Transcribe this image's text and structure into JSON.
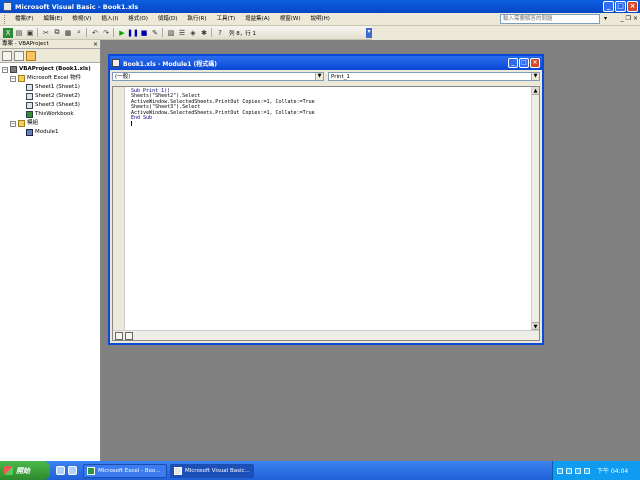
{
  "window": {
    "title": "Microsoft Visual Basic - Book1.xls"
  },
  "menu": {
    "items": [
      "檔案(F)",
      "編輯(E)",
      "檢視(V)",
      "插入(I)",
      "格式(O)",
      "偵錯(D)",
      "執行(R)",
      "工具(T)",
      "增益集(A)",
      "視窗(W)",
      "說明(H)"
    ],
    "help_placeholder": "輸入需要解答的問題"
  },
  "toolbar": {
    "position_text": "列 8，行 1"
  },
  "project_explorer": {
    "title": "專案 - VBAProject",
    "nodes": [
      {
        "label": "VBAProject (Book1.xls)",
        "level": 0
      },
      {
        "label": "Microsoft Excel 物件",
        "level": 1
      },
      {
        "label": "Sheet1 (Sheet1)",
        "level": 2
      },
      {
        "label": "Sheet2 (Sheet2)",
        "level": 2
      },
      {
        "label": "Sheet3 (Sheet3)",
        "level": 2
      },
      {
        "label": "ThisWorkbook",
        "level": 2
      },
      {
        "label": "模組",
        "level": 1
      },
      {
        "label": "Module1",
        "level": 2
      }
    ]
  },
  "code_window": {
    "title": "Book1.xls - Module1 (程式碼)",
    "object_combo": "(一般)",
    "procedure_combo": "Print_1",
    "lines": [
      "Sub Print_1()",
      "Sheets(\"Sheet2\").Select",
      "ActiveWindow.SelectedSheets.PrintOut Copies:=1, Collate:=True",
      "",
      "Sheets(\"Sheet3\").Select",
      "ActiveWindow.SelectedSheets.PrintOut Copies:=1, Collate:=True",
      "End Sub",
      ""
    ]
  },
  "taskbar": {
    "start_label": "開始",
    "tasks": [
      "Microsoft Excel - Boo...",
      "Microsoft Visual Basic..."
    ],
    "clock": "下午 04:04"
  }
}
